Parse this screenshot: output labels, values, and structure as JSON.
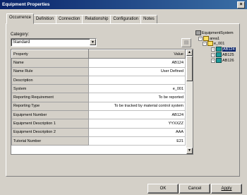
{
  "window": {
    "title": "Equipment Properties",
    "close_glyph": "×"
  },
  "tabs": [
    "Occurrence",
    "Definition",
    "Connection",
    "Relationship",
    "Configuration",
    "Notes"
  ],
  "category": {
    "label": "Category:",
    "value": "Standard"
  },
  "grid": {
    "header": {
      "property": "Property",
      "value": "Value"
    },
    "rows": [
      {
        "property": "Name",
        "value": "AB124"
      },
      {
        "property": "Name Rule",
        "value": "User Defined"
      },
      {
        "property": "Description",
        "value": ""
      },
      {
        "property": "System",
        "value": "e_001"
      },
      {
        "property": "Reporting Requirement",
        "value": "To be reported"
      },
      {
        "property": "Reporting Type",
        "value": "To be tracked by material control system"
      },
      {
        "property": "Equipment Number",
        "value": "AB124"
      },
      {
        "property": "Equipment Description 1",
        "value": "YYXXZZ"
      },
      {
        "property": "Equipment Description 2",
        "value": "AAA"
      },
      {
        "property": "Tutorial Number",
        "value": "E21"
      }
    ]
  },
  "tree": {
    "root": "EquipmentSystem",
    "area": "area1",
    "system": "e_001",
    "items": [
      "AB124",
      "AB125",
      "AB126"
    ],
    "selected": "AB124"
  },
  "buttons": {
    "ok": "OK",
    "cancel": "Cancel",
    "apply": "Apply"
  },
  "icons": {
    "tree_root": "equipment-system-icon",
    "tree_area": "folder-icon",
    "tree_equipment": "equipment-icon",
    "toolbar_button": "properties-icon"
  }
}
